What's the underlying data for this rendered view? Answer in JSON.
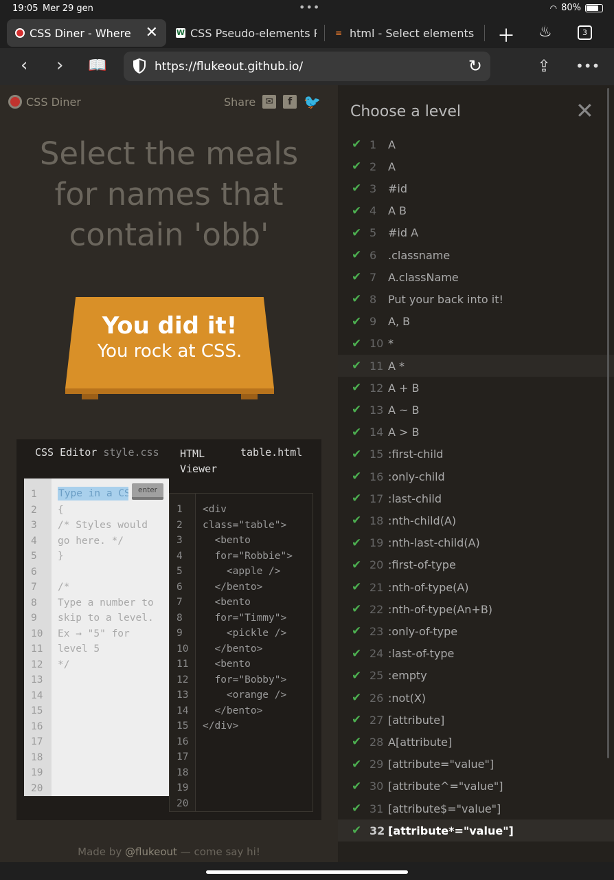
{
  "status": {
    "time": "19:05",
    "date": "Mer 29 gen",
    "battery": "80%",
    "battery_fraction": 0.8
  },
  "tabs": [
    {
      "label": "CSS Diner - Where we feed on CSS",
      "active": true
    },
    {
      "label": "CSS Pseudo-elements Reference"
    },
    {
      "label": "html - Select elements by attribute"
    }
  ],
  "tab_count": "3",
  "url": "https://flukeout.github.io/",
  "game": {
    "logo": "CSS Diner",
    "share": "Share",
    "heading": "Select the meals for names that contain 'obb'",
    "win_title": "You did it!",
    "win_sub": "You rock at CSS."
  },
  "editor": {
    "css_title": "CSS Editor",
    "css_file": "style.css",
    "html_title": "HTML Viewer",
    "html_file": "table.html",
    "input_placeholder": "Type in a CSS selector",
    "enter": "enter",
    "css_line_numbers": "1\n2\n3\n4\n5\n6\n7\n8\n9\n10\n11\n12\n13\n14\n15\n16\n17\n18\n19\n20",
    "css_code": "\n{\n/* Styles would\ngo here. */\n}\n\n/*\nType a number to\nskip to a level.\nEx → \"5\" for\nlevel 5\n*/",
    "html_line_numbers": "1\n2\n3\n4\n5\n6\n7\n8\n9\n10\n11\n12\n13\n14\n15\n16\n17\n18\n19\n20",
    "html_code": "<div\nclass=\"table\">\n  <bento\n  for=\"Robbie\">\n    <apple />\n  </bento>\n  <bento\n  for=\"Timmy\">\n    <pickle />\n  </bento>\n  <bento\n  for=\"Bobby\">\n    <orange />\n  </bento>\n</div>"
  },
  "footer": {
    "prefix": "Made by",
    "author": "@flukeout",
    "suffix": "— come say hi!"
  },
  "levels": {
    "title": "Choose a level",
    "items": [
      {
        "n": "1",
        "name": "A"
      },
      {
        "n": "2",
        "name": "A"
      },
      {
        "n": "3",
        "name": "#id"
      },
      {
        "n": "4",
        "name": "A  B"
      },
      {
        "n": "5",
        "name": "#id  A"
      },
      {
        "n": "6",
        "name": ".classname"
      },
      {
        "n": "7",
        "name": "A.className"
      },
      {
        "n": "8",
        "name": "Put your back into it!"
      },
      {
        "n": "9",
        "name": "A, B"
      },
      {
        "n": "10",
        "name": "*"
      },
      {
        "n": "11",
        "name": "A  *"
      },
      {
        "n": "12",
        "name": "A + B"
      },
      {
        "n": "13",
        "name": "A ~ B"
      },
      {
        "n": "14",
        "name": "A > B"
      },
      {
        "n": "15",
        "name": ":first-child"
      },
      {
        "n": "16",
        "name": ":only-child"
      },
      {
        "n": "17",
        "name": ":last-child"
      },
      {
        "n": "18",
        "name": ":nth-child(A)"
      },
      {
        "n": "19",
        "name": ":nth-last-child(A)"
      },
      {
        "n": "20",
        "name": ":first-of-type"
      },
      {
        "n": "21",
        "name": ":nth-of-type(A)"
      },
      {
        "n": "22",
        "name": ":nth-of-type(An+B)"
      },
      {
        "n": "23",
        "name": ":only-of-type"
      },
      {
        "n": "24",
        "name": ":last-of-type"
      },
      {
        "n": "25",
        "name": ":empty"
      },
      {
        "n": "26",
        "name": ":not(X)"
      },
      {
        "n": "27",
        "name": "[attribute]"
      },
      {
        "n": "28",
        "name": "A[attribute]"
      },
      {
        "n": "29",
        "name": "[attribute=\"value\"]"
      },
      {
        "n": "30",
        "name": "[attribute^=\"value\"]"
      },
      {
        "n": "31",
        "name": "[attribute$=\"value\"]"
      },
      {
        "n": "32",
        "name": "[attribute*=\"value\"]"
      }
    ]
  },
  "colors": {
    "accent": "#4caf50",
    "table": "#e0962c"
  }
}
